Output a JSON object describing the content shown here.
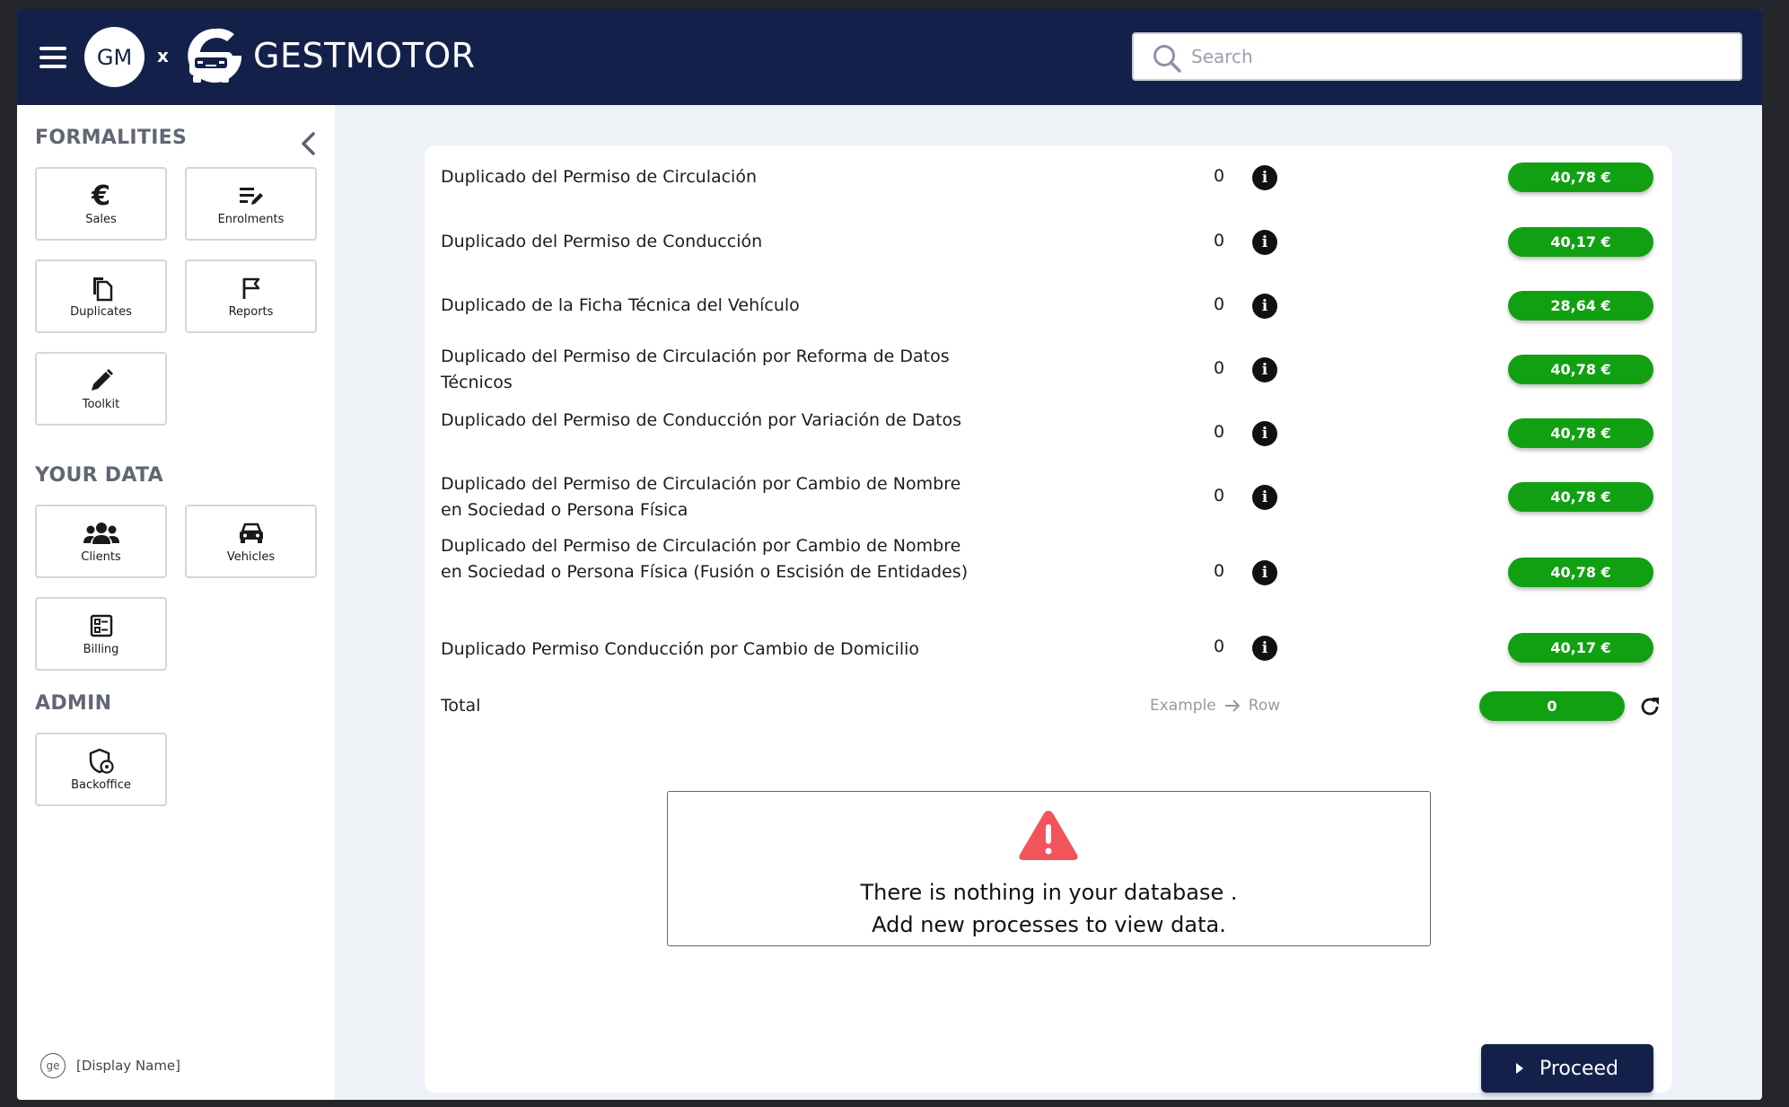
{
  "header": {
    "gm_badge": "GM",
    "separator": "x",
    "brand": "GESTMOTOR",
    "search_placeholder": "Search"
  },
  "sidebar": {
    "sections": {
      "formalities": "FORMALITIES",
      "your_data": "YOUR DATA",
      "admin": "ADMIN"
    },
    "tiles": {
      "sales": "Sales",
      "enrolments": "Enrolments",
      "duplicates": "Duplicates",
      "reports": "Reports",
      "toolkit": "Toolkit",
      "clients": "Clients",
      "vehicles": "Vehicles",
      "billing": "Billing",
      "backoffice": "Backoffice"
    },
    "user": {
      "avatar": "ge",
      "display_name": "[Display Name]"
    }
  },
  "main": {
    "rows": [
      {
        "name": "Duplicado del Permiso de Circulación",
        "qty": "0",
        "price": "40,78 €"
      },
      {
        "name": "Duplicado del Permiso de Conducción",
        "qty": "0",
        "price": "40,17 €"
      },
      {
        "name": "Duplicado de la Ficha Técnica del Vehículo",
        "qty": "0",
        "price": "28,64 €"
      },
      {
        "name": "Duplicado del Permiso de Circulación por Reforma de Datos Técnicos",
        "qty": "0",
        "price": "40,78 €"
      },
      {
        "name": "Duplicado del Permiso de Conducción por Variación de Datos",
        "qty": "0",
        "price": "40,78 €"
      },
      {
        "name": "Duplicado del Permiso de Circulación por Cambio de Nombre en Sociedad o Persona Física",
        "qty": "0",
        "price": "40,78 €"
      },
      {
        "name": "Duplicado del Permiso de Circulación por Cambio de Nombre en Sociedad o Persona Física (Fusión o Escisión de Entidades)",
        "qty": "0",
        "price": "40,78 €"
      },
      {
        "name": "Duplicado Permiso Conducción por Cambio de Domicilio",
        "qty": "0",
        "price": "40,17 €"
      }
    ],
    "total": {
      "label": "Total",
      "example": "Example",
      "row": "Row",
      "value": "0"
    },
    "empty": {
      "line1": "There is nothing in your database .",
      "line2": "Add new processes to view data."
    },
    "proceed": "Proceed"
  },
  "colors": {
    "header_bg": "#13214a",
    "price_green": "#12a013",
    "warning_red": "#f2545b",
    "main_bg": "#eef1f6"
  }
}
